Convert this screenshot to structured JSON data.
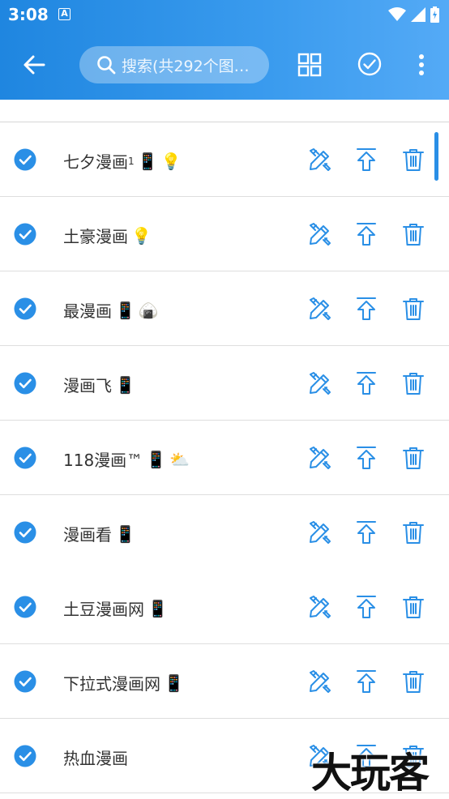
{
  "status_bar": {
    "time": "3:08",
    "notification_icon_letter": "A",
    "icons": [
      "wifi-icon",
      "signal-icon",
      "battery-icon"
    ]
  },
  "toolbar": {
    "back_icon": "arrow-left-icon",
    "search_placeholder": "搜索(共292个图…",
    "grid_icon": "grid-view-icon",
    "check_icon": "check-circle-icon",
    "more_icon": "more-vert-icon"
  },
  "colors": {
    "primary": "#2a8fe6",
    "appbar_start": "#1f86e0",
    "appbar_end": "#54aaf6",
    "text": "#333333",
    "divider": "#dedede"
  },
  "items": [
    {
      "name": "七夕漫画",
      "subscript": "1",
      "emojis": [
        "📱",
        "💡"
      ],
      "checked": true
    },
    {
      "name": "土豪漫画",
      "subscript": "",
      "emojis": [
        "💡"
      ],
      "checked": true
    },
    {
      "name": "最漫画",
      "subscript": "",
      "emojis": [
        "📱",
        "🍙"
      ],
      "checked": true
    },
    {
      "name": "漫画飞",
      "subscript": "",
      "emojis": [
        "📱"
      ],
      "checked": true
    },
    {
      "name": "118漫画™",
      "subscript": "",
      "emojis": [
        "📱",
        "⛅"
      ],
      "checked": true
    },
    {
      "name": "漫画看",
      "subscript": "",
      "emojis": [
        "📱"
      ],
      "checked": true
    },
    {
      "name": "土豆漫画网",
      "subscript": "",
      "emojis": [
        "📱"
      ],
      "checked": true
    },
    {
      "name": "下拉式漫画网",
      "subscript": "",
      "emojis": [
        "📱"
      ],
      "checked": true
    },
    {
      "name": "热血漫画",
      "subscript": "",
      "emojis": [],
      "checked": true
    }
  ],
  "row_actions": [
    "edit-icon",
    "upload-icon",
    "delete-icon"
  ],
  "watermark": "大玩客"
}
